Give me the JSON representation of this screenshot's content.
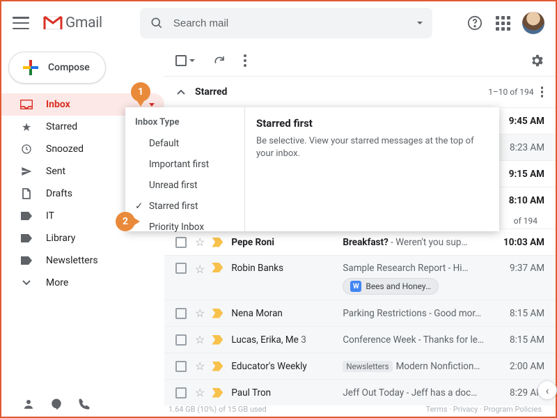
{
  "app": {
    "name": "Gmail"
  },
  "search": {
    "placeholder": "Search mail"
  },
  "compose": {
    "label": "Compose"
  },
  "sidebar": {
    "items": [
      {
        "label": "Inbox"
      },
      {
        "label": "Starred"
      },
      {
        "label": "Snoozed"
      },
      {
        "label": "Sent"
      },
      {
        "label": "Drafts"
      },
      {
        "label": "IT"
      },
      {
        "label": "Library"
      },
      {
        "label": "Newsletters"
      },
      {
        "label": "More"
      }
    ]
  },
  "section": {
    "starred": {
      "title": "Starred",
      "count": "1–10 of 194"
    },
    "else": {
      "count": "of 194"
    }
  },
  "popup": {
    "header": "Inbox Type",
    "options": [
      "Default",
      "Important first",
      "Unread first",
      "Starred first",
      "Priority Inbox"
    ],
    "detail_title": "Starred first",
    "detail_body": "Be selective. View your starred messages at the top of your inbox."
  },
  "rows": [
    {
      "sender": "",
      "subject": "",
      "snippet": "",
      "time": "9:45 AM",
      "unread": true
    },
    {
      "sender": "",
      "subject": "",
      "snippet": "",
      "time": "8:23 AM",
      "unread": false
    },
    {
      "sender": "",
      "subject": "",
      "snippet": "",
      "time": "9:15 AM",
      "unread": true
    },
    {
      "sender": "",
      "subject": "",
      "snippet": "",
      "time": "8:10 AM",
      "unread": true
    },
    {
      "sender": "Pepe Roni",
      "subject": "Breakfast?",
      "snippet": " - Weren't you sup…",
      "time": "10:03 AM",
      "unread": true
    },
    {
      "sender": "Robin Banks",
      "subject": "Sample Research Report",
      "snippet": " - Hi…",
      "time": "9:37 AM",
      "unread": false,
      "chip": "Bees and Honey…"
    },
    {
      "sender": "Nena Moran",
      "subject": "Parking Restrictions",
      "snippet": " - Good mor…",
      "time": "8:15 AM",
      "unread": false
    },
    {
      "sender": "Lucas, Erika, Me",
      "count": "3",
      "subject": "Conference Week",
      "snippet": " - Thanks for le…",
      "time": "8:15 AM",
      "unread": false
    },
    {
      "sender": "Educator's Weekly",
      "subject": "Modern Nonfiction…",
      "tag": "Newsletters",
      "time": "2:00 AM",
      "unread": false
    },
    {
      "sender": "Paul Tron",
      "subject": "Jeff Out Today",
      "snippet": " - Jeff has a doc…",
      "time": "8:29 AM",
      "unread": false
    }
  ],
  "callouts": {
    "c1": "1",
    "c2": "2"
  },
  "footer": {
    "storage": "1.64 GB (10%) of 15 GB used",
    "right": "Terms · Privacy · Program Policies"
  }
}
